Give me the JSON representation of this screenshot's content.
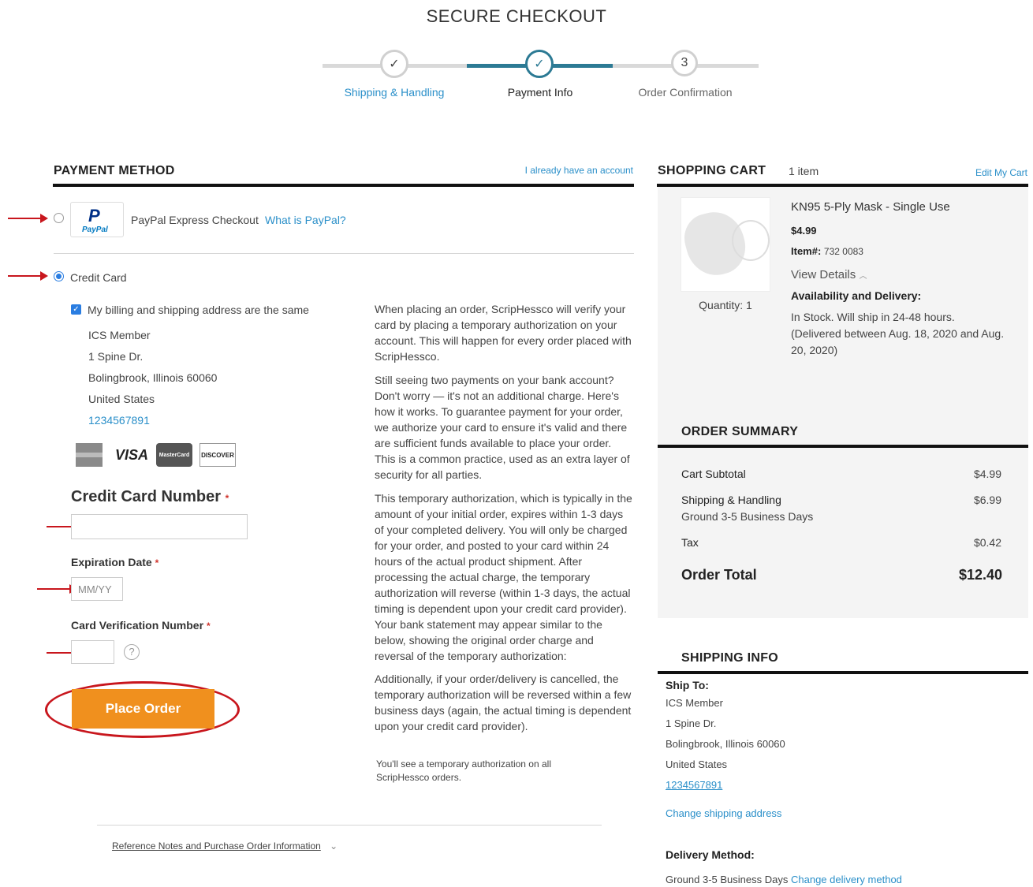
{
  "header": {
    "title": "SECURE CHECKOUT",
    "steps": [
      {
        "label": "Shipping & Handling",
        "marker": "✓"
      },
      {
        "label": "Payment Info",
        "marker": "✓"
      },
      {
        "label": "Order Confirmation",
        "marker": "3"
      }
    ]
  },
  "payment": {
    "title": "PAYMENT METHOD",
    "account_link": "I already have an account",
    "paypal": {
      "label": "PayPal Express Checkout",
      "link": "What is PayPal?",
      "logo_text": "PayPal"
    },
    "credit_card": {
      "label": "Credit Card"
    },
    "same_address": "My billing and shipping address are the same",
    "address": [
      "ICS Member",
      "1 Spine Dr.",
      "Bolingbrook, Illinois 60060",
      "United States"
    ],
    "phone": "1234567891",
    "card_logos": [
      "VISA",
      "MasterCard",
      "DISCOVER"
    ],
    "card_number_label": "Credit Card Number",
    "expiration_label": "Expiration Date",
    "expiration_placeholder": "MM/YY",
    "cvv_label": "Card Verification Number",
    "required_mark": "*",
    "place_order": "Place Order",
    "reference_link": "Reference Notes and Purchase Order Information",
    "info_paragraphs": [
      "When placing an order, ScripHessco will verify your card by placing a temporary authorization on your account. This will happen for every order placed with ScripHessco.",
      "Still seeing two payments on your bank account? Don't worry — it's not an additional charge. Here's how it works. To guarantee payment for your order, we authorize your card to ensure it's valid and there are sufficient funds available to place your order. This is a common practice, used as an extra layer of security for all parties.",
      "This temporary authorization, which is typically in the amount of your initial order, expires within 1-3 days of your completed delivery. You will only be charged for your order, and posted to your card within 24 hours of the actual product shipment. After processing the actual charge, the temporary authorization will reverse (within 1-3 days, the actual timing is dependent upon your credit card provider). Your bank statement may appear similar to the below, showing the original order charge and reversal of the temporary authorization:",
      "Additionally, if your order/delivery is cancelled, the temporary authorization will be reversed within a few business days (again, the actual timing is dependent upon your credit card provider)."
    ],
    "footnote": "You'll see a temporary authorization on all ScripHessco orders."
  },
  "cart": {
    "title": "SHOPPING CART",
    "count": "1 item",
    "edit_link": "Edit My Cart",
    "item": {
      "name": "KN95 5-Ply Mask - Single Use",
      "price": "$4.99",
      "item_label": "Item#:",
      "item_number": "732 0083",
      "quantity": "Quantity: 1",
      "view_details": "View Details",
      "availability_title": "Availability and Delivery:",
      "availability_text": "In Stock. Will ship in 24-48 hours. (Delivered between Aug. 18, 2020 and Aug. 20, 2020)"
    }
  },
  "summary": {
    "title": "ORDER SUMMARY",
    "subtotal_label": "Cart Subtotal",
    "subtotal": "$4.99",
    "shipping_label": "Shipping & Handling",
    "shipping_method": "Ground 3-5 Business Days",
    "shipping": "$6.99",
    "tax_label": "Tax",
    "tax": "$0.42",
    "total_label": "Order Total",
    "total": "$12.40"
  },
  "shipping_info": {
    "title": "SHIPPING INFO",
    "ship_to_label": "Ship To:",
    "address": [
      "ICS Member",
      "1 Spine Dr.",
      "Bolingbrook, Illinois 60060",
      "United States"
    ],
    "phone": "1234567891",
    "change_address": "Change shipping address",
    "delivery_label": "Delivery Method:",
    "delivery_method": "Ground 3-5 Business Days",
    "change_delivery": "Change delivery method"
  },
  "colors": {
    "accent": "#2a8fc9",
    "progress_active": "#2c7a94",
    "order_button": "#f0901e",
    "annotation": "#c8161d"
  }
}
